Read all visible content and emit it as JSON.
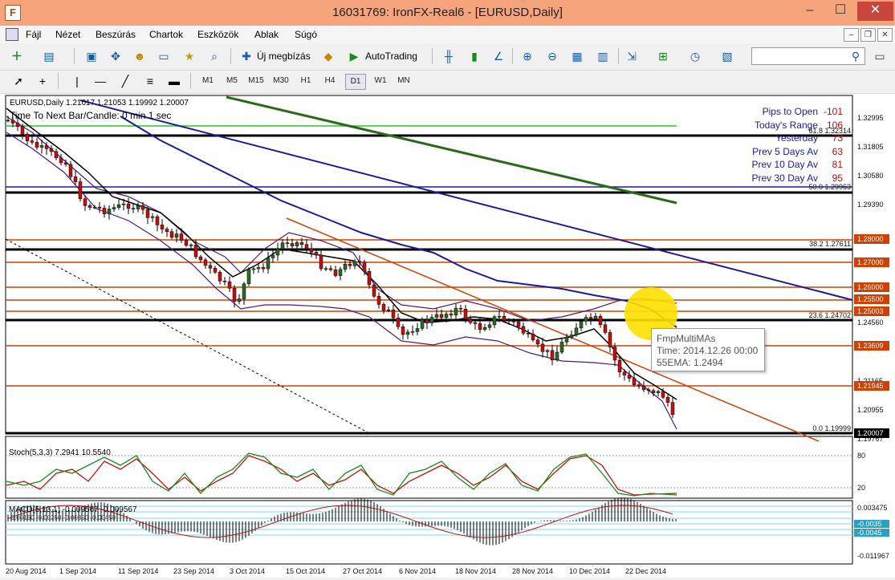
{
  "window": {
    "title": "16031769: IronFX-Real6 - [EURUSD,Daily]",
    "minimize": "–",
    "maximize": "☐",
    "close": "✕"
  },
  "menu": {
    "items": [
      "Fájl",
      "Nézet",
      "Beszúrás",
      "Chartok",
      "Eszközök",
      "Ablak",
      "Súgó"
    ]
  },
  "toolbar": {
    "new_order": "Új megbízás",
    "autotrading": "AutoTrading",
    "search_value": "",
    "search_icon": "magnifier-icon"
  },
  "timeframes": {
    "items": [
      "M1",
      "M5",
      "M15",
      "M30",
      "H1",
      "H4",
      "D1",
      "W1",
      "MN"
    ],
    "active": "D1"
  },
  "chart": {
    "header": "EURUSD,Daily  1.21017 1.21053 1.19992 1.20007",
    "next_bar": "Time To Next Bar/Candle: 0 min 1 sec",
    "colors": {
      "up_candle": "#2a6a2a",
      "down_candle": "#c01010",
      "support_line": "#d04000",
      "ema55": "#1a1a9a",
      "ema200": "#2a6a1a",
      "highlight": "#ffe000"
    }
  },
  "stats_panel": [
    {
      "label": "Pips to Open",
      "value": "-101"
    },
    {
      "label": "Today's Range",
      "value": "106"
    },
    {
      "label": "Yesterday",
      "value": "73"
    },
    {
      "label": "Prev 5 Days Av",
      "value": "63"
    },
    {
      "label": "Prev 10 Day Av",
      "value": "81"
    },
    {
      "label": "Prev 30 Day Av",
      "value": "95"
    }
  ],
  "fib_labels": {
    "f618": "61.8 1.32314",
    "f500": "50.0 1.29963",
    "f382": "38.2 1.27611",
    "f236": "23.6 1.24702",
    "f000": "0.0 1.19999"
  },
  "price_axis": {
    "labels": [
      "1.32995",
      "1.31805",
      "1.30580",
      "1.29390",
      "1.24560",
      "1.21165",
      "1.20955",
      "1.19767"
    ],
    "badges": {
      "b1": "1.28000",
      "b2": "1.27000",
      "b3": "1.26000",
      "b4": "1.25500",
      "b5": "1.25003",
      "b6": "1.23609",
      "b7": "1.21945",
      "b8": "1.20007"
    }
  },
  "tooltip": {
    "title": "FmpMultiMAs",
    "time": "Time: 2014.12.26 00:00",
    "ema": "55EMA: 1.2494"
  },
  "stoch": {
    "label": "Stoch(5,3,3) 7.2941 10.5540",
    "level80": "80",
    "level20": "20"
  },
  "macd": {
    "label": "MACD(5,13,1) -0.009567 -0.009567",
    "left_levels": "-0.00150 -0.00250 -0.00350 -0.00450",
    "axis_top": "0.003475",
    "axis_bottom": "-0.011967",
    "badge1": "-0.0035",
    "badge2": "-0.0045"
  },
  "dates": [
    "20 Aug 2014",
    "1 Sep 2014",
    "11 Sep 2014",
    "23 Sep 2014",
    "3 Oct 2014",
    "15 Oct 2014",
    "27 Oct 2014",
    "6 Nov 2014",
    "18 Nov 2014",
    "28 Nov 2014",
    "10 Dec 2014",
    "22 Dec 2014"
  ]
}
